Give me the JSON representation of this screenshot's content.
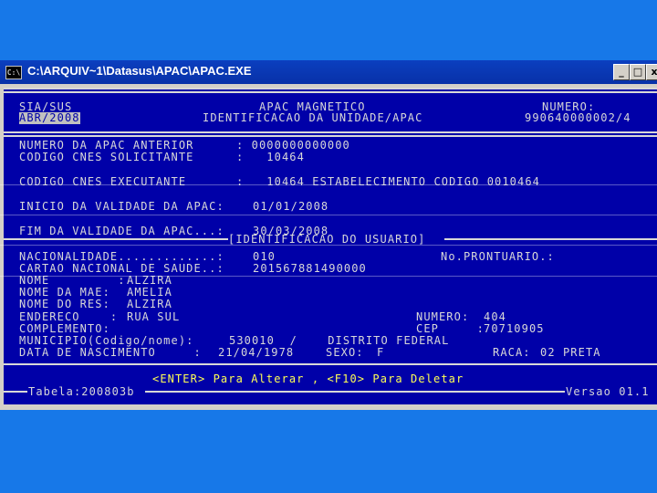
{
  "window": {
    "title": "C:\\ARQUIV~1\\Datasus\\APAC\\APAC.EXE",
    "icon": "C:\\",
    "controls": {
      "minimize": "_",
      "maximize": "□",
      "close": "x"
    }
  },
  "colors": {
    "background": "#1778e8",
    "console_bg": "#0000a8",
    "console_text": "#d8d8d8",
    "highlight_text": "#ffff55",
    "titlebar": "#0b3fbf"
  },
  "header": {
    "system": "SIA/SUS",
    "period": "ABR/2008",
    "title1": "APAC MAGNETICO",
    "title2": "IDENTIFICACAO DA UNIDADE/APAC",
    "numero_label": "NUMERO:",
    "numero_value": "990640000002/4"
  },
  "unidade": {
    "apac_anterior_label": "NUMERO DA APAC ANTERIOR",
    "apac_anterior_value": ": 0000000000000",
    "cnes_solicitante_label": "CODIGO CNES SOLICITANTE",
    "cnes_solicitante_value": ":   10464",
    "cnes_executante_label": "CODIGO CNES EXECUTANTE",
    "cnes_executante_value": ":   10464 ESTABELECIMENTO CODIGO 0010464",
    "inicio_label": "INICIO DA VALIDADE DA APAC:",
    "inicio_value": "01/01/2008",
    "fim_label": "FIM DA VALIDADE DA APAC...:",
    "fim_value": "30/03/2008"
  },
  "usuario": {
    "section_title": "[IDENTIFICACAO DO USUARIO]",
    "nacionalidade_label": "NACIONALIDADE.............:",
    "nacionalidade_value": "010",
    "prontuario_label": "No.PRONTUARIO.:",
    "cartao_label": "CARTAO NACIONAL DE SAUDE..:",
    "cartao_value": "201567881490000",
    "nome_label": "NOME         :",
    "nome_value": "ALZIRA",
    "mae_label": "NOME DA MAE:",
    "mae_value": "AMELIA",
    "res_label": "NOME DO RES:",
    "res_value": "ALZIRA",
    "endereco_label": "ENDERECO    :",
    "endereco_value": "RUA SUL",
    "numero_label": "NUMERO:",
    "numero_value": "404",
    "complemento_label": "COMPLEMENTO:",
    "cep_label": "CEP     :",
    "cep_value": "70710905",
    "municipio_label": "MUNICIPIO(Codigo/nome):",
    "municipio_value": "530010  /    DISTRITO FEDERAL",
    "nascimento_label": "DATA DE NASCIMENTO     :",
    "nascimento_value": "21/04/1978",
    "sexo_label": "SEXO:",
    "sexo_value": "F",
    "raca_label": "RACA:",
    "raca_value": "02 PRETA"
  },
  "footer": {
    "actions": "<ENTER> Para Alterar , <F10> Para Deletar",
    "tabela": "Tabela:200803b",
    "versao": "Versao 01.1"
  }
}
